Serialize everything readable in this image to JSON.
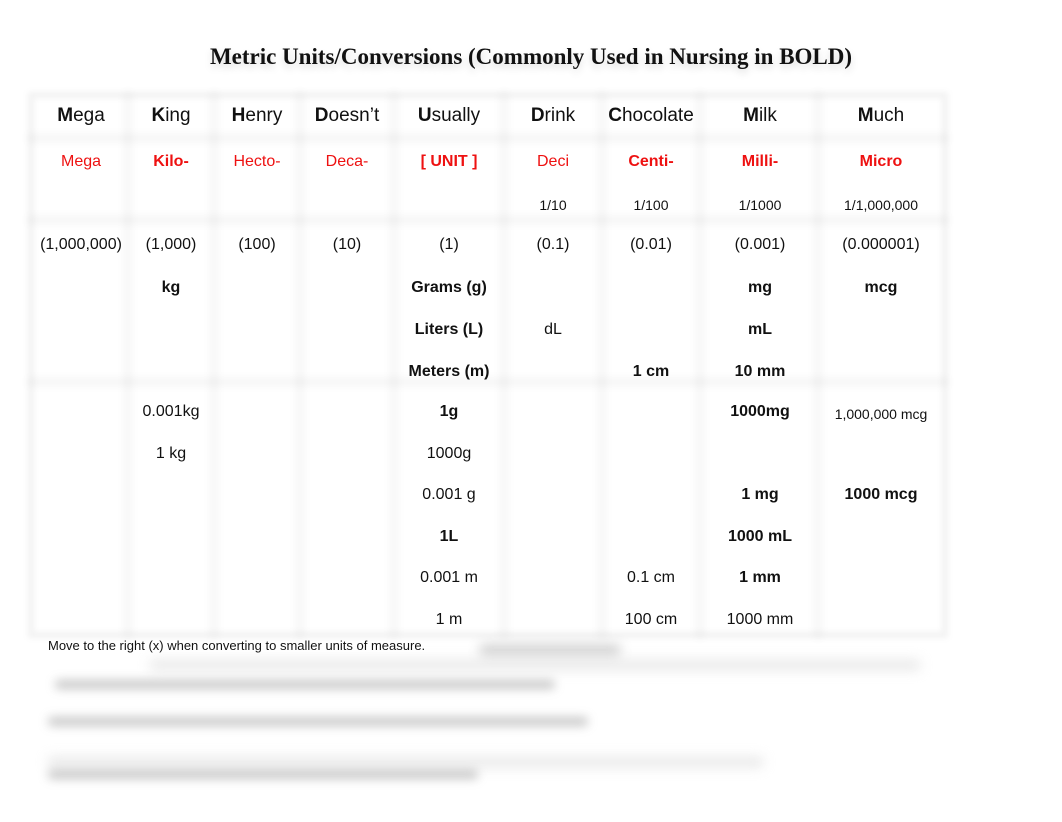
{
  "title": "Metric Units/Conversions (Commonly Used in Nursing in BOLD)",
  "columns": [
    {
      "mnemonic_first": "M",
      "mnemonic_rest": "ega",
      "prefix": "Mega",
      "prefix_bold": false,
      "fraction": "",
      "multiplier": "(1,000,000)"
    },
    {
      "mnemonic_first": "K",
      "mnemonic_rest": "ing",
      "prefix": "Kilo-",
      "prefix_bold": true,
      "fraction": "",
      "multiplier": "(1,000)"
    },
    {
      "mnemonic_first": "H",
      "mnemonic_rest": "enry",
      "prefix": "Hecto-",
      "prefix_bold": false,
      "fraction": "",
      "multiplier": "(100)"
    },
    {
      "mnemonic_first": "D",
      "mnemonic_rest": "oesn’t",
      "prefix": "Deca-",
      "prefix_bold": false,
      "fraction": "",
      "multiplier": "(10)"
    },
    {
      "mnemonic_first": "U",
      "mnemonic_rest": "sually",
      "prefix": "[ UNIT ]",
      "prefix_bold": true,
      "fraction": "",
      "multiplier": "(1)"
    },
    {
      "mnemonic_first": "D",
      "mnemonic_rest": "rink",
      "prefix": "Deci",
      "prefix_bold": false,
      "fraction": "1/10",
      "multiplier": "(0.1)"
    },
    {
      "mnemonic_first": "C",
      "mnemonic_rest": "hocolate",
      "prefix": "Centi-",
      "prefix_bold": true,
      "fraction": "1/100",
      "multiplier": "(0.01)"
    },
    {
      "mnemonic_first": "M",
      "mnemonic_rest": "ilk",
      "prefix": "Milli-",
      "prefix_bold": true,
      "fraction": "1/1000",
      "multiplier": "(0.001)"
    },
    {
      "mnemonic_first": "M",
      "mnemonic_rest": "uch",
      "prefix": "Micro",
      "prefix_bold": true,
      "fraction": "1/1,000,000",
      "multiplier": "(0.000001)"
    }
  ],
  "units_rows": [
    [
      "",
      "kg",
      "",
      "",
      "Grams (g)",
      "",
      "",
      "mg",
      "mcg"
    ],
    [
      "",
      "",
      "",
      "",
      "Liters (L)",
      "dL",
      "",
      "mL",
      ""
    ],
    [
      "",
      "",
      "",
      "",
      "Meters (m)",
      "",
      "1 cm",
      "10 mm",
      ""
    ]
  ],
  "conversion_rows": [
    [
      "",
      "0.001kg",
      "",
      "",
      "1g",
      "",
      "",
      "1000mg",
      "1,000,000 mcg"
    ],
    [
      "",
      "1 kg",
      "",
      "",
      "1000g",
      "",
      "",
      "",
      ""
    ],
    [
      "",
      "",
      "",
      "",
      "0.001 g",
      "",
      "",
      "1 mg",
      "1000 mcg"
    ],
    [
      "",
      "",
      "",
      "",
      "1L",
      "",
      "",
      "1000 mL",
      ""
    ],
    [
      "",
      "",
      "",
      "",
      "0.001 m",
      "",
      "0.1 cm",
      "1 mm",
      ""
    ],
    [
      "",
      "",
      "",
      "",
      "1 m",
      "",
      "100 cm",
      "1000 mm",
      ""
    ]
  ],
  "note": "Move to the right (x) when converting to smaller units of measure.",
  "colors": {
    "prefix_red": "#ee1111",
    "text": "#111111"
  }
}
